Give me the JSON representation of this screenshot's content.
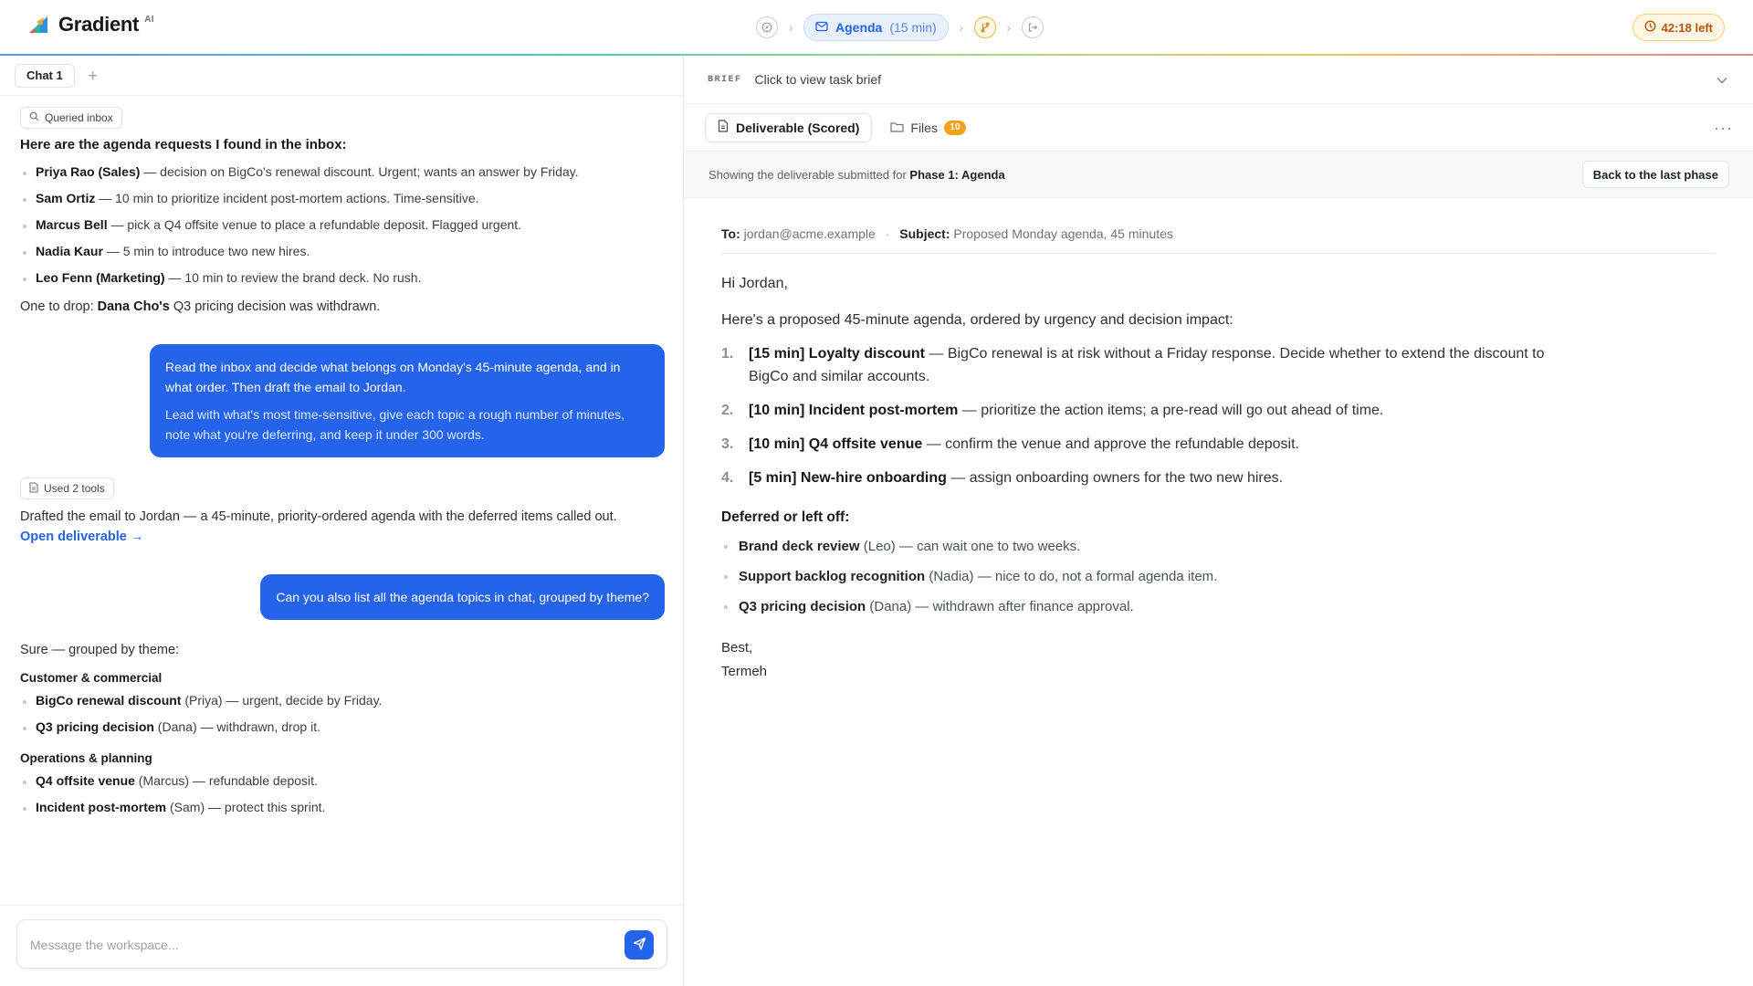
{
  "app": {
    "name": "Gradient",
    "badge": "AI"
  },
  "stepper": {
    "current_label": "Agenda",
    "current_duration": "(15 min)"
  },
  "timer": {
    "label": "42:18 left"
  },
  "left": {
    "tab_label": "Chat 1",
    "add_tab_glyph": "+",
    "msg1": {
      "tool_label": "Queried inbox",
      "title": "Here are the agenda requests I found in the inbox:",
      "items": [
        {
          "name": "Priya Rao (Sales)",
          "text": " — decision on BigCo's renewal discount. Urgent; wants an answer by Friday."
        },
        {
          "name": "Sam Ortiz",
          "text": " — 10 min to prioritize incident post-mortem actions. Time-sensitive."
        },
        {
          "name": "Marcus Bell",
          "text": " — pick a Q4 offsite venue to place a refundable deposit. Flagged urgent."
        },
        {
          "name": "Nadia Kaur",
          "text": " — 5 min to introduce two new hires."
        },
        {
          "name": "Leo Fenn (Marketing)",
          "text": " — 10 min to review the brand deck. No rush."
        }
      ],
      "drop_prefix": "One to drop: ",
      "drop_name": "Dana Cho's",
      "drop_suffix": " Q3 pricing decision was withdrawn."
    },
    "user1": {
      "p1": "Read the inbox and decide what belongs on Monday's 45-minute agenda, and in what order. Then draft the email to Jordan.",
      "p2": "Lead with what's most time-sensitive, give each topic a rough number of minutes, note what you're deferring, and keep it under 300 words."
    },
    "msg2": {
      "tool_label": "Used 2 tools",
      "text": "Drafted the email to Jordan — a 45-minute, priority-ordered agenda with the deferred items called out. ",
      "link": "Open deliverable",
      "link_arrow": "→"
    },
    "user2": {
      "text": "Can you also list all the agenda topics in chat, grouped by theme?"
    },
    "msg3": {
      "intro": "Sure — grouped by theme:",
      "groups": [
        {
          "title": "Customer & commercial",
          "items": [
            {
              "name": "BigCo renewal discount",
              "owner": " (Priya)",
              "text": " — urgent, decide by Friday."
            },
            {
              "name": "Q3 pricing decision",
              "owner": " (Dana)",
              "text": " — withdrawn, drop it."
            }
          ]
        },
        {
          "title": "Operations & planning",
          "items": [
            {
              "name": "Q4 offsite venue",
              "owner": " (Marcus)",
              "text": " — refundable deposit."
            },
            {
              "name": "Incident post-mortem",
              "owner": " (Sam)",
              "text": " — protect this sprint."
            }
          ]
        }
      ]
    },
    "composer": {
      "placeholder": "Message the workspace..."
    }
  },
  "right": {
    "brief": {
      "tag": "BRIEF",
      "text": "Click to view task brief"
    },
    "tabs": {
      "deliverable": "Deliverable (Scored)",
      "files": "Files",
      "files_count": "10",
      "more": "···"
    },
    "info": {
      "prefix": "Showing the deliverable submitted for ",
      "phase": "Phase 1: Agenda",
      "back_button": "Back to the last phase"
    },
    "email": {
      "to_label": "To:",
      "to": "jordan@acme.example",
      "separator": "·",
      "subject_label": "Subject:",
      "subject": "Proposed Monday agenda, 45 minutes",
      "greeting": "Hi Jordan,",
      "intro": "Here's a proposed 45-minute agenda, ordered by urgency and decision impact:",
      "items": [
        {
          "num": "1.",
          "title": "[15 min] Loyalty discount",
          "text": " — BigCo renewal is at risk without a Friday response. Decide whether to extend the discount to BigCo and similar accounts."
        },
        {
          "num": "2.",
          "title": "[10 min] Incident post-mortem",
          "text": " — prioritize the action items; a pre-read will go out ahead of time."
        },
        {
          "num": "3.",
          "title": "[10 min] Q4 offsite venue",
          "text": " — confirm the venue and approve the refundable deposit."
        },
        {
          "num": "4.",
          "title": "[5 min] New-hire onboarding",
          "text": " — assign onboarding owners for the two new hires."
        }
      ],
      "deferred_title": "Deferred or left off:",
      "deferred": [
        {
          "title": "Brand deck review",
          "owner": " (Leo)",
          "text": " — can wait one to two weeks."
        },
        {
          "title": "Support backlog recognition",
          "owner": " (Nadia)",
          "text": " — nice to do, not a formal agenda item."
        },
        {
          "title": "Q3 pricing decision",
          "owner": " (Dana)",
          "text": " — withdrawn after finance approval."
        }
      ],
      "closing": "Best,",
      "signature": "Termeh"
    }
  },
  "colors": {
    "accent": "#2563eb",
    "timer": "#b45309",
    "badge": "#f0a21f"
  }
}
